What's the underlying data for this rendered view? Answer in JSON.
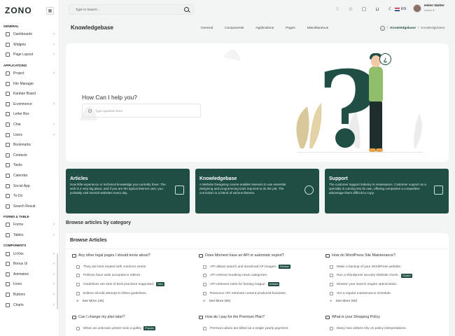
{
  "logo": "ZONO",
  "sidebar": {
    "sections": [
      {
        "title": "GENERAL",
        "items": [
          {
            "label": "Dashboards",
            "arrow": true
          },
          {
            "label": "Widgets",
            "arrow": true
          },
          {
            "label": "Page Layout",
            "arrow": true
          }
        ]
      },
      {
        "title": "APPLICATIONS",
        "items": [
          {
            "label": "Project",
            "arrow": true
          },
          {
            "label": "File Manager",
            "arrow": false
          },
          {
            "label": "Kanban Board",
            "arrow": false
          },
          {
            "label": "Ecommerce",
            "arrow": true
          },
          {
            "label": "Letter Box",
            "arrow": false
          },
          {
            "label": "Chat",
            "arrow": true
          },
          {
            "label": "Users",
            "arrow": true
          },
          {
            "label": "Bookmarks",
            "arrow": false
          },
          {
            "label": "Contacts",
            "arrow": false
          },
          {
            "label": "Tasks",
            "arrow": false
          },
          {
            "label": "Calendar",
            "arrow": false
          },
          {
            "label": "Social App",
            "arrow": false
          },
          {
            "label": "To-Do",
            "arrow": false
          },
          {
            "label": "Search Result",
            "arrow": false
          }
        ]
      },
      {
        "title": "FORMS & TABLE",
        "items": [
          {
            "label": "Forms",
            "arrow": true
          },
          {
            "label": "Tables",
            "arrow": true
          }
        ]
      },
      {
        "title": "COMPONENTS",
        "items": [
          {
            "label": "Ui Kits",
            "arrow": true
          },
          {
            "label": "Bonus Ui",
            "arrow": true
          },
          {
            "label": "Animation",
            "arrow": true
          },
          {
            "label": "Icons",
            "arrow": true
          },
          {
            "label": "Buttons",
            "arrow": true
          },
          {
            "label": "Charts",
            "arrow": true
          }
        ]
      }
    ]
  },
  "header": {
    "search_placeholder": "Type to Search ..",
    "language": "EN",
    "user_name": "Helen Walter",
    "user_role": "Admin"
  },
  "page": {
    "title": "Knowledgebase",
    "menu": [
      "General",
      "Components",
      "Applications",
      "Pages",
      "Miscellaneous"
    ],
    "breadcrumb": [
      "Knowledgebase",
      "Knowledgebase"
    ]
  },
  "hero": {
    "question": "How Can I help you?",
    "input_placeholder": "Type question here",
    "bubble_glyph": "¿"
  },
  "features": [
    {
      "title": "Articles",
      "text": "How little experience or technical knowledge you currently have. The web is a very big place, and if you are the typical internet user, you probably visit several websites every day."
    },
    {
      "title": "Knowledgebase",
      "text": "A Website Designing course enables learners to use essential designing and programming tools required to do the job. The curriculum is a blend of various themes."
    },
    {
      "title": "Support",
      "text": "The customer support industry is renaissance. Customer support as a specialty is coming into its own, offering companies a competitive advantage that's difficult to copy."
    }
  ],
  "browse_heading": "Browse articles by category",
  "browse": {
    "title": "Browse Articles",
    "columns": [
      {
        "title": "Any other legal pages I should know about?",
        "items": [
          {
            "text": "They are best treated with common sense.",
            "badge": ""
          },
          {
            "text": "Policies have wide acceptance editors.",
            "badge": ""
          },
          {
            "text": "Guidelines are sets of best practices supported.",
            "badge": "New"
          },
          {
            "text": "Editors should attempt to follow guidelines.",
            "badge": ""
          }
        ],
        "more": "See More (40)"
      },
      {
        "title": "Does Moment have an API or automatic export?",
        "items": [
          {
            "text": "API allows search and download AP Images.",
            "badge": "Review"
          },
          {
            "text": "API retrieve breaking news categories.",
            "badge": ""
          },
          {
            "text": "API retrieves rules for fantasy league.",
            "badge": "Articles"
          },
          {
            "text": "Resource API retrieves content produced business.",
            "badge": ""
          }
        ],
        "more": "See More (90)"
      },
      {
        "title": "How do WordPress Site Maintenance?",
        "items": [
          {
            "text": "Make a backup of your WordPress website.",
            "badge": ""
          },
          {
            "text": "Run a Wordpress security Website check.",
            "badge": "Closed"
          },
          {
            "text": "Monitor your search engine optimization.",
            "badge": ""
          },
          {
            "text": "Set a regular maintenance schedule.",
            "badge": ""
          }
        ],
        "more": "See More (50)"
      }
    ],
    "second_row": [
      {
        "title": "Can I change my plan later?",
        "first": "When an unknown printer took a galley",
        "badge": "Popular"
      },
      {
        "title": "How do I pay for the Premium Plan?",
        "first": "Premium plans are billed as a single yearly payment.",
        "badge": ""
      },
      {
        "title": "What is your Shopping Policy",
        "first": "Many new editors rely on policy interpretations.",
        "badge": ""
      }
    ]
  },
  "colors": {
    "brand": "#1f4e45",
    "background": "#f3f5f5"
  }
}
